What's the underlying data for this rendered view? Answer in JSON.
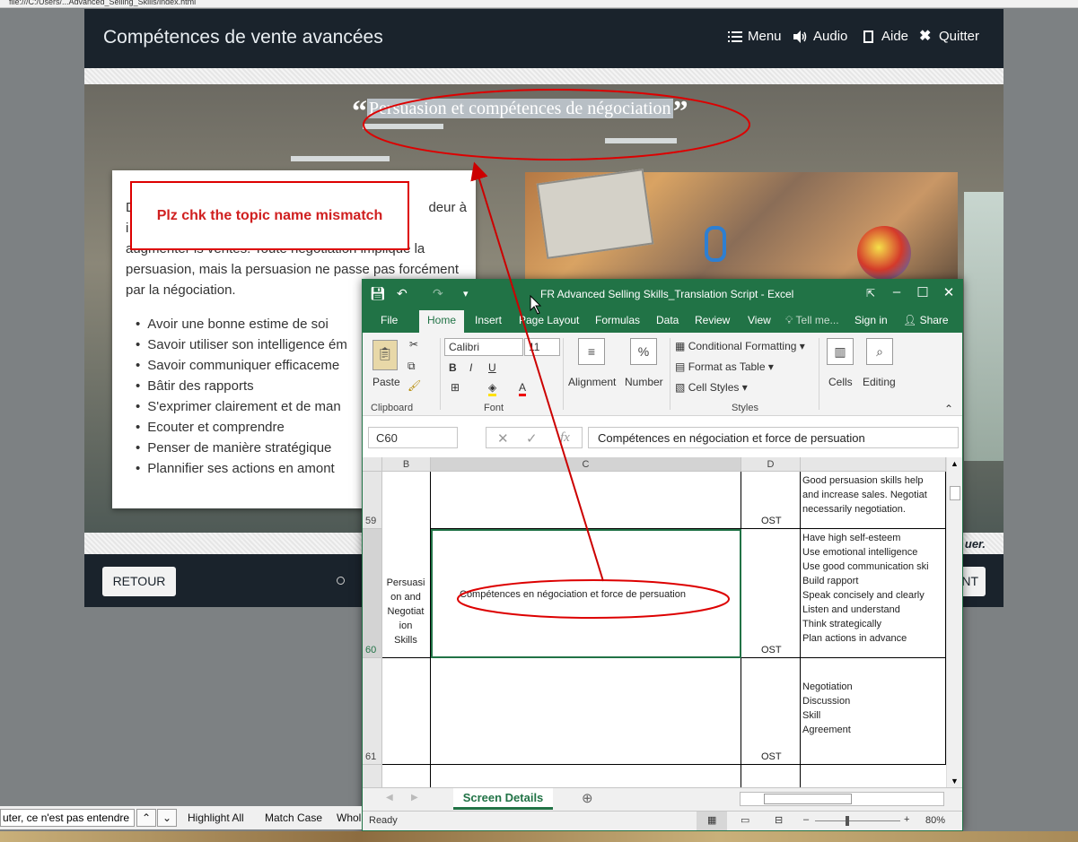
{
  "browser": {
    "url_text": "file:///C:/Users/...Advanced_Selling_Skills/index.html"
  },
  "course": {
    "title": "Compétences de vente avancées",
    "nav": {
      "menu": "Menu",
      "audio": "Audio",
      "help": "Aide",
      "quit": "Quitter"
    },
    "quote": "Persuasion et compétences de négociation",
    "quote_open": "“",
    "quote_close": "”",
    "paragraph": "De nombreux vendeurs assimilent la grandeur à ir ... augmenter les ventes. Toute négotiation implique la persuasion, mais la persuasion ne passe pas forcément par la négociation.",
    "para_line1_start": "D",
    "para_line1_end": "deur à",
    "para_line2_start": "i",
    "para_line3": "augmenter ls ventes. Toute négotiation implique la",
    "para_line4": "persuasion, mais la persuasion ne passe pas forcément",
    "para_line5": "par la négociation.",
    "bullets": [
      "Avoir une bonne estime de soi",
      "Savoir utiliser son intelligence ém",
      "Savoir communiquer efficaceme",
      "Bâtir des rapports",
      "S'exprimer clairement et de man",
      "Ecouter et comprendre",
      "Penser de manière stratégique",
      "Plannifier ses actions en amont"
    ],
    "jouer": "uer.",
    "back_button": "RETOUR",
    "next_button": "NT"
  },
  "annotation": {
    "note": "Plz chk the topic name mismatch"
  },
  "excel": {
    "window_title": "FR Advanced Selling Skills_Translation Script - Excel",
    "tabs": [
      "File",
      "Home",
      "Insert",
      "Page Layout",
      "Formulas",
      "Data",
      "Review",
      "View"
    ],
    "tell_me": "Tell me...",
    "sign_in": "Sign in",
    "share": "Share",
    "ribbon": {
      "paste": "Paste",
      "clipboard": "Clipboard",
      "font_name": "Calibri",
      "font_size": "11",
      "font": "Font",
      "alignment": "Alignment",
      "number": "Number",
      "conditional_formatting": "Conditional Formatting",
      "format_as_table": "Format as Table",
      "cell_styles": "Cell Styles",
      "styles": "Styles",
      "cells": "Cells",
      "editing": "Editing",
      "bold": "B",
      "italic": "I",
      "underline": "U",
      "percent": "%"
    },
    "name_box": "C60",
    "formula": "Compétences en négociation et force de persuation",
    "fx": "fx",
    "columns": [
      "B",
      "C",
      "D"
    ],
    "rows": [
      {
        "num": "59",
        "b": "",
        "c": "",
        "d": "OST",
        "e": [
          "Good persuasion skills help",
          "and increase sales. Negotiat",
          "necessarily negotiation."
        ]
      },
      {
        "num": "60",
        "b": [
          "Persuasi",
          "on and",
          "Negotiat",
          "ion",
          "Skills"
        ],
        "c": "Compétences en négociation et force de persuation",
        "d": "OST",
        "e": [
          "Have high self-esteem",
          "Use emotional intelligence",
          "Use good communication ski",
          "Build rapport",
          "Speak concisely and clearly",
          "Listen and understand",
          "Think strategically",
          "Plan actions in advance"
        ]
      },
      {
        "num": "61",
        "b": "",
        "c": "",
        "d": "OST",
        "e": [
          "Negotiation",
          "Discussion",
          "Skill",
          "Agreement"
        ]
      }
    ],
    "sheet_tab": "Screen Details",
    "status": "Ready",
    "zoom": "80%"
  },
  "findbar": {
    "value": "uter, ce n'est pas entendre !",
    "highlight_all": "Highlight All",
    "match_case": "Match Case",
    "whole": "Whol"
  },
  "colors": {
    "excel_green": "#217346",
    "course_dark": "#1a232c",
    "annotation_red": "#d00000"
  }
}
